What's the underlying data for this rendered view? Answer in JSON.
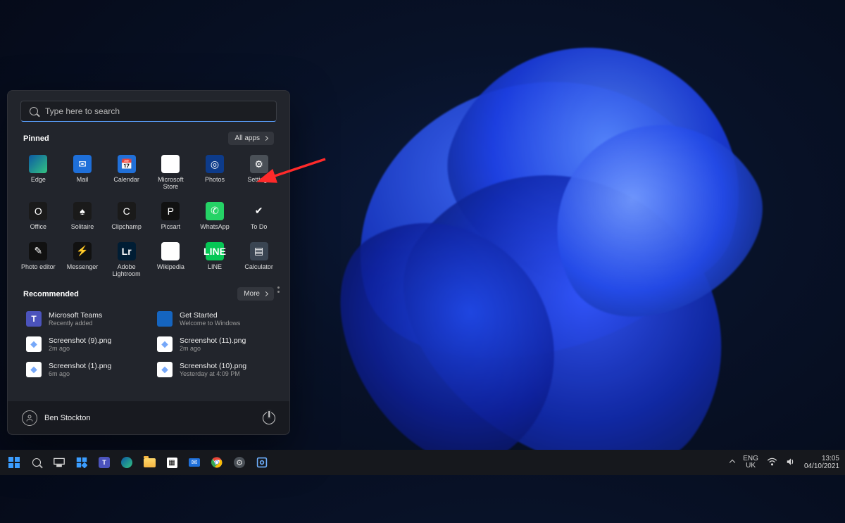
{
  "search": {
    "placeholder": "Type here to search"
  },
  "sections": {
    "pinned": "Pinned",
    "all_apps": "All apps",
    "recommended": "Recommended",
    "more": "More"
  },
  "pinned": [
    {
      "label": "Edge",
      "cls": "edge"
    },
    {
      "label": "Mail",
      "cls": "mail"
    },
    {
      "label": "Calendar",
      "cls": "cal"
    },
    {
      "label": "Microsoft Store",
      "cls": "store"
    },
    {
      "label": "Photos",
      "cls": "photos"
    },
    {
      "label": "Settings",
      "cls": "gear"
    },
    {
      "label": "Office",
      "cls": "office"
    },
    {
      "label": "Solitaire",
      "cls": "sol"
    },
    {
      "label": "Clipchamp",
      "cls": "clip"
    },
    {
      "label": "Picsart",
      "cls": "pics"
    },
    {
      "label": "WhatsApp",
      "cls": "wa"
    },
    {
      "label": "To Do",
      "cls": "todo"
    },
    {
      "label": "Photo editor",
      "cls": "pe"
    },
    {
      "label": "Messenger",
      "cls": "msgr"
    },
    {
      "label": "Adobe Lightroom",
      "cls": "lr"
    },
    {
      "label": "Wikipedia",
      "cls": "wiki"
    },
    {
      "label": "LINE",
      "cls": "line"
    },
    {
      "label": "Calculator",
      "cls": "calc"
    }
  ],
  "recommended_items": [
    {
      "title": "Microsoft Teams",
      "sub": "Recently added",
      "icon": "teams-ico"
    },
    {
      "title": "Get Started",
      "sub": "Welcome to Windows",
      "icon": "gs-ico"
    },
    {
      "title": "Screenshot (9).png",
      "sub": "2m ago",
      "icon": "file-ico"
    },
    {
      "title": "Screenshot (11).png",
      "sub": "2m ago",
      "icon": "file-ico"
    },
    {
      "title": "Screenshot (1).png",
      "sub": "6m ago",
      "icon": "file-ico"
    },
    {
      "title": "Screenshot (10).png",
      "sub": "Yesterday at 4:09 PM",
      "icon": "file-ico"
    }
  ],
  "user": {
    "name": "Ben Stockton"
  },
  "system_tray": {
    "lang1": "ENG",
    "lang2": "UK",
    "time": "13:05",
    "date": "04/10/2021"
  },
  "taskbar_icons": [
    "start",
    "search",
    "task-view",
    "widgets",
    "teams",
    "edge",
    "file-explorer",
    "store",
    "mail",
    "chrome",
    "settings",
    "snip"
  ]
}
